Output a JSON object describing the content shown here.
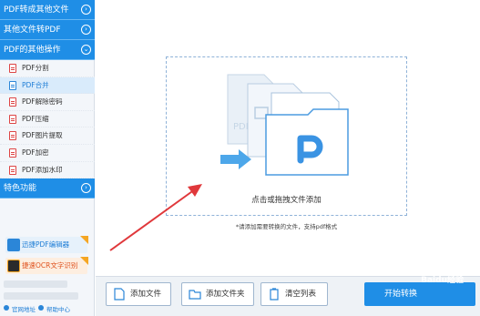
{
  "sidebar": {
    "categories": [
      {
        "label": "PDF转成其他文件",
        "chevron": "›"
      },
      {
        "label": "其他文件转PDF",
        "chevron": "›"
      },
      {
        "label": "PDF的其他操作",
        "chevron": "⌄"
      },
      {
        "label": "特色功能",
        "chevron": "›"
      }
    ],
    "items": [
      {
        "label": "PDF分割"
      },
      {
        "label": "PDF合并"
      },
      {
        "label": "PDF解除密码"
      },
      {
        "label": "PDF压缩"
      },
      {
        "label": "PDF图片提取"
      },
      {
        "label": "PDF加密"
      },
      {
        "label": "PDF添加水印"
      }
    ],
    "active_item": "PDF合并",
    "promos": [
      {
        "label": "迅捷PDF编辑器",
        "icon": "pdf-editor-icon"
      },
      {
        "label": "捷速OCR文字识别",
        "icon": "ocr-icon"
      }
    ],
    "footer": {
      "link1": "官网地址",
      "link2": "帮助中心"
    }
  },
  "main": {
    "drop_text": "点击或拖拽文件添加",
    "hint": "*请添加需要转换的文件，支持pdf格式",
    "buttons": {
      "add_file": "添加文件",
      "add_folder": "添加文件夹",
      "clear_list": "清空列表",
      "start": "开始转换"
    }
  },
  "watermark": "Baidu经验",
  "colors": {
    "accent": "#1f8ee6",
    "sidebar_bg": "#f3f6fa",
    "annotation_arrow": "#e0383b"
  }
}
